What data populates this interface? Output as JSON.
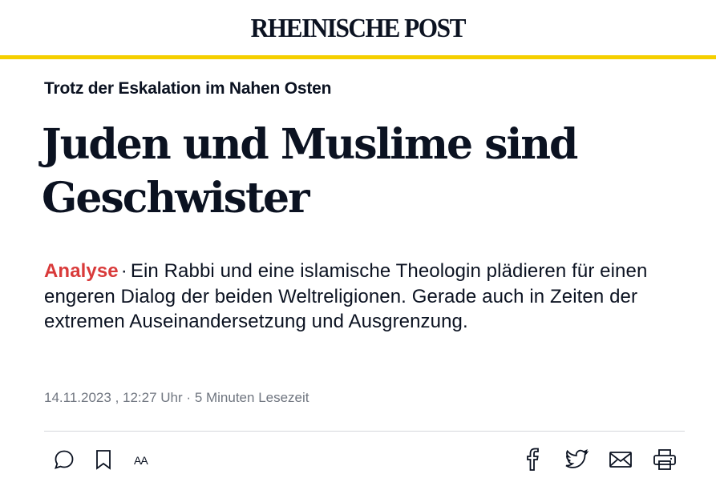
{
  "masthead": {
    "logo_text": "RHEINISCHE POST"
  },
  "colors": {
    "accent": "#f5cf00",
    "label_red": "#d93a3a",
    "text": "#0b1221",
    "meta": "#707680"
  },
  "article": {
    "kicker": "Trotz der Eskalation im Nahen Osten",
    "headline_line1": "Juden und Muslime sind",
    "headline_line2": "Geschwister",
    "teaser_label": "Analyse",
    "teaser_separator": "·",
    "teaser_text": "Ein Rabbi und eine islamische Theologin plädieren für einen engeren Dialog der beiden Weltreligionen. Gerade auch in Zeiten der extremen Auseinandersetzung und Ausgrenzung.",
    "date": "14.11.2023",
    "time": ", 12:27 Uhr",
    "meta_separator": "·",
    "reading_time": "5 Minuten Lesezeit"
  },
  "toolbar": {
    "left": [
      "comment-icon",
      "bookmark-icon",
      "font-size-icon"
    ],
    "font_size_glyph": "AA",
    "right": [
      "facebook-icon",
      "twitter-icon",
      "mail-icon",
      "print-icon"
    ]
  }
}
